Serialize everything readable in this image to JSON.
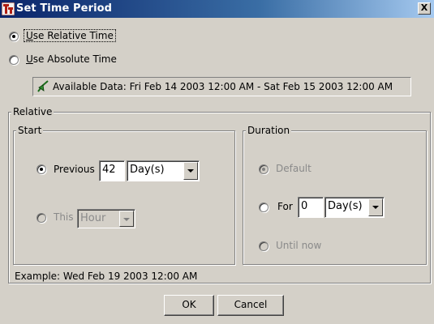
{
  "window": {
    "title": "Set Time Period",
    "close_label": "X"
  },
  "mode": {
    "relative_label": "Use Relative Time",
    "absolute_label": "Use Absolute Time",
    "selected": "relative"
  },
  "available": {
    "text": "Available Data: Fri Feb 14 2003 12:00 AM - Sat Feb 15 2003 12:00 AM"
  },
  "relative": {
    "group_label": "Relative",
    "start": {
      "group_label": "Start",
      "previous_label": "Previous",
      "previous_value": "42",
      "previous_unit": "Day(s)",
      "this_label": "This",
      "this_unit": "Hour",
      "selected": "previous"
    },
    "duration": {
      "group_label": "Duration",
      "default_label": "Default",
      "for_label": "For",
      "for_value": "0",
      "for_unit": "Day(s)",
      "until_now_label": "Until now",
      "selected": "default"
    }
  },
  "example": {
    "text": "Example:  Wed Feb 19 2003 12:00 AM"
  },
  "buttons": {
    "ok": "OK",
    "cancel": "Cancel"
  },
  "colors": {
    "titlebar_start": "#0a246a",
    "titlebar_end": "#a6caf0",
    "face": "#d4d0c8",
    "disabled_text": "#8a8a8a"
  }
}
